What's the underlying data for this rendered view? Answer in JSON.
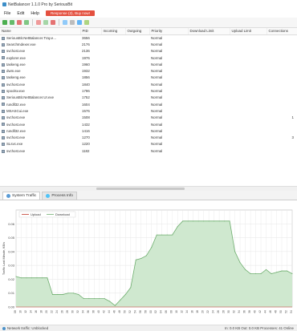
{
  "window": {
    "title": "NetBalancer 1.1.0 Pro by SeriousBit"
  },
  "menu": {
    "items": [
      "File",
      "Edit",
      "Help"
    ],
    "alert": "Response (2), Buy now!"
  },
  "toolbar": {
    "icons": [
      "limit-icon",
      "priority-icon",
      "block-icon",
      "refresh-icon",
      "filter-icon",
      "settings-icon",
      "chart-icon",
      "network-icon",
      "window-icon",
      "options-icon"
    ]
  },
  "table": {
    "columns": [
      "Name",
      "PID",
      "Incoming",
      "Outgoing",
      "Priority",
      "Download Limit",
      "Upload Limit",
      "Connections"
    ],
    "rows": [
      {
        "name": "SeriousBit.NetBalancer.Tray.e...",
        "pid": "3656",
        "priority": "Normal",
        "connections": ""
      },
      {
        "name": "SearchIndexer.exe",
        "pid": "2176",
        "priority": "Normal",
        "connections": ""
      },
      {
        "name": "svchost.exe",
        "pid": "2136",
        "priority": "Normal",
        "connections": ""
      },
      {
        "name": "explorer.exe",
        "pid": "1976",
        "priority": "Normal",
        "connections": ""
      },
      {
        "name": "taskeng.exe",
        "pid": "1960",
        "priority": "Normal",
        "connections": ""
      },
      {
        "name": "dwm.exe",
        "pid": "1932",
        "priority": "Normal",
        "connections": ""
      },
      {
        "name": "taskeng.exe",
        "pid": "1856",
        "priority": "Normal",
        "connections": ""
      },
      {
        "name": "svchost.exe",
        "pid": "1840",
        "priority": "Normal",
        "connections": ""
      },
      {
        "name": "spoolsv.exe",
        "pid": "1796",
        "priority": "Normal",
        "connections": ""
      },
      {
        "name": "SeriousBit.NetBalancer.UI.exe",
        "pid": "1752",
        "priority": "Normal",
        "connections": ""
      },
      {
        "name": "rundll32.exe",
        "pid": "1604",
        "priority": "Normal",
        "connections": ""
      },
      {
        "name": "MSASCui.exe",
        "pid": "1576",
        "priority": "Normal",
        "connections": ""
      },
      {
        "name": "svchost.exe",
        "pid": "1508",
        "priority": "Normal",
        "connections": "1"
      },
      {
        "name": "svchost.exe",
        "pid": "1432",
        "priority": "Normal",
        "connections": ""
      },
      {
        "name": "rundll32.exe",
        "pid": "1416",
        "priority": "Normal",
        "connections": ""
      },
      {
        "name": "svchost.exe",
        "pid": "1270",
        "priority": "Normal",
        "connections": "3"
      },
      {
        "name": "SLsvc.exe",
        "pid": "1220",
        "priority": "Normal",
        "connections": ""
      },
      {
        "name": "svchost.exe",
        "pid": "1182",
        "priority": "Normal",
        "connections": ""
      }
    ]
  },
  "tabs": [
    {
      "label": "System Traffic",
      "active": true
    },
    {
      "label": "Process Info",
      "active": false
    }
  ],
  "chart_data": {
    "type": "area",
    "title": "",
    "ylabel": "Traffic Last Minute, KB/s",
    "xlabel": "",
    "ylim": [
      0,
      0.07
    ],
    "yticks": [
      "0.00",
      "0.01",
      "0.02",
      "0.03",
      "0.04",
      "0.05",
      "0.06"
    ],
    "legend": [
      "Upload",
      "Download"
    ],
    "legend_position": "top-left",
    "colors": {
      "fill": "#cfe8cf",
      "line": "#6fae6f",
      "grid": "#e6e6e6"
    },
    "x": [
      "55:08",
      "55:10",
      "55:12",
      "55:14",
      "55:16",
      "55:18",
      "55:20",
      "55:22",
      "55:24",
      "55:26",
      "55:28",
      "55:30",
      "55:32",
      "55:34",
      "55:36",
      "55:38",
      "55:40",
      "55:42",
      "55:44",
      "55:46",
      "55:48",
      "55:50",
      "55:52",
      "55:54",
      "55:56",
      "55:58",
      "56:00",
      "56:02",
      "56:04",
      "56:06",
      "56:08",
      "56:10",
      "56:12",
      "56:14",
      "56:16",
      "56:18",
      "56:20",
      "56:22",
      "56:24",
      "56:26",
      "56:28",
      "56:30",
      "56:32",
      "56:34",
      "56:36",
      "56:38",
      "56:40",
      "56:42",
      "56:44",
      "56:46",
      "56:48",
      "56:50",
      "56:52",
      "56:54"
    ],
    "series": [
      {
        "name": "Download",
        "values": [
          0.022,
          0.021,
          0.021,
          0.021,
          0.021,
          0.021,
          0.021,
          0.009,
          0.009,
          0.009,
          0.01,
          0.01,
          0.009,
          0.006,
          0.006,
          0.006,
          0.006,
          0.006,
          0.004,
          0.001,
          0.005,
          0.009,
          0.014,
          0.034,
          0.035,
          0.037,
          0.043,
          0.052,
          0.052,
          0.052,
          0.052,
          0.058,
          0.062,
          0.062,
          0.062,
          0.062,
          0.062,
          0.062,
          0.062,
          0.062,
          0.062,
          0.062,
          0.04,
          0.032,
          0.027,
          0.024,
          0.024,
          0.024,
          0.027,
          0.024,
          0.025,
          0.026,
          0.026,
          0.024
        ]
      },
      {
        "name": "Upload",
        "values": [
          0.0,
          0.0,
          0.0,
          0.0,
          0.0,
          0.0,
          0.0,
          0.0,
          0.0,
          0.0,
          0.0,
          0.0,
          0.0,
          0.0,
          0.0,
          0.0,
          0.0,
          0.0,
          0.0,
          0.0,
          0.0,
          0.0,
          0.0,
          0.0,
          0.0,
          0.0,
          0.0,
          0.0,
          0.0,
          0.0,
          0.0,
          0.0,
          0.0,
          0.0,
          0.0,
          0.0,
          0.0,
          0.0,
          0.0,
          0.0,
          0.0,
          0.0,
          0.0,
          0.0,
          0.0,
          0.0,
          0.0,
          0.0,
          0.0,
          0.0,
          0.0,
          0.0,
          0.0,
          0.0
        ]
      }
    ]
  },
  "status": {
    "left": "Network traffic: Unblocked",
    "right": "In: 0.0 KB   Out: 0.0 KB   Processes: 41   Online"
  }
}
